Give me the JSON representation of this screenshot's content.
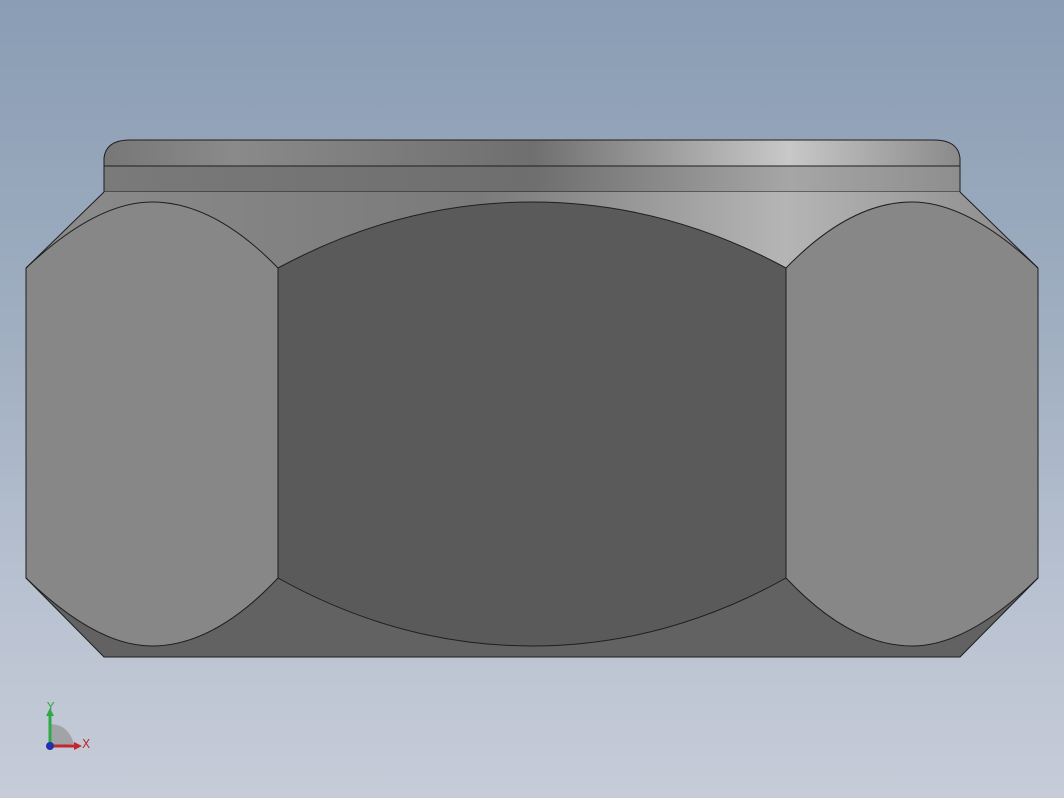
{
  "viewport": {
    "background_top": "#8a9db4",
    "background_bottom": "#c6ccd8"
  },
  "model": {
    "name": "hex lock nut",
    "view": "front",
    "colors": {
      "center_face": "#5a5a5a",
      "side_face": "#888888",
      "chamfer": "#6a6a6a",
      "collar": "#8c8c8c",
      "edge": "#1e1e1e"
    }
  },
  "triad": {
    "x_label": "X",
    "y_label": "Y",
    "x_color": "#c0282d",
    "y_color": "#2fa84a",
    "z_color": "#2231a8"
  }
}
